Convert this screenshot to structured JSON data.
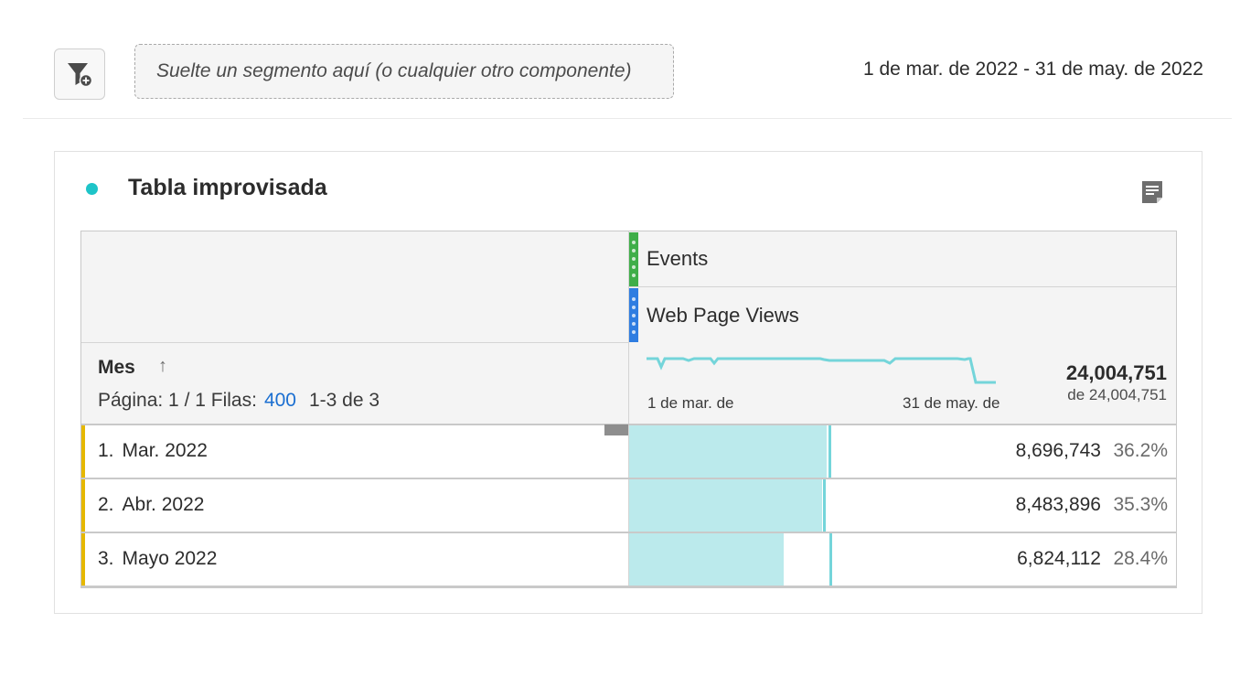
{
  "toolbar": {
    "drop_zone_text": "Suelte un segmento aquí (o cualquier otro componente)",
    "date_range": "1 de mar. de 2022 - 31 de may. de 2022"
  },
  "panel": {
    "title": "Tabla improvisada",
    "accent_color": "#1ec4c8"
  },
  "table": {
    "metrics": [
      {
        "label": "Events",
        "color": "#3fae49"
      },
      {
        "label": "Web Page Views",
        "color": "#2f7de1"
      }
    ],
    "dimension": {
      "name": "Mes",
      "sort_arrow": "↑",
      "pager_prefix": "Página: 1 / 1 Filas:",
      "rows_per_page": "400",
      "row_range": "1-3 de 3"
    },
    "sparkline": {
      "start_label": "1 de mar. de",
      "end_label": "31 de may. de"
    },
    "total": {
      "value": "24,004,751",
      "of": "de 24,004,751"
    },
    "rows": [
      {
        "num": "1.",
        "label": "Mar. 2022",
        "value": "8,696,743",
        "pct": "36.2%",
        "fraction": 0.362
      },
      {
        "num": "2.",
        "label": "Abr. 2022",
        "value": "8,483,896",
        "pct": "35.3%",
        "fraction": 0.353
      },
      {
        "num": "3.",
        "label": "Mayo 2022",
        "value": "6,824,112",
        "pct": "28.4%",
        "fraction": 0.284
      }
    ]
  },
  "icons": {
    "filter": "filter-add-icon",
    "notes": "notes-icon"
  }
}
